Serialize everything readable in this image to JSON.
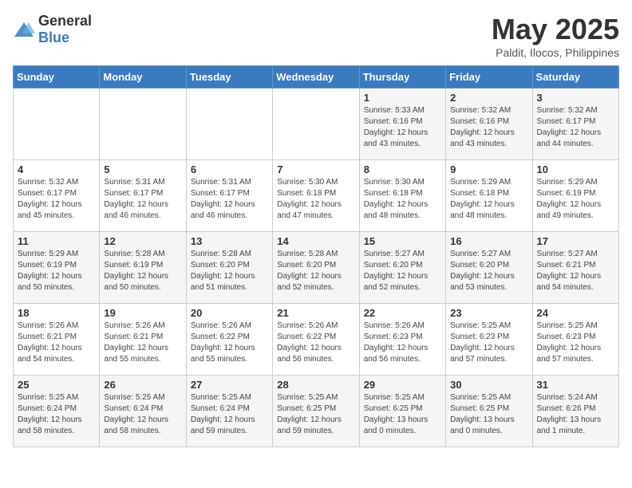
{
  "logo": {
    "text_general": "General",
    "text_blue": "Blue"
  },
  "title": "May 2025",
  "location": "Paldit, Ilocos, Philippines",
  "weekdays": [
    "Sunday",
    "Monday",
    "Tuesday",
    "Wednesday",
    "Thursday",
    "Friday",
    "Saturday"
  ],
  "weeks": [
    [
      {
        "day": "",
        "info": ""
      },
      {
        "day": "",
        "info": ""
      },
      {
        "day": "",
        "info": ""
      },
      {
        "day": "",
        "info": ""
      },
      {
        "day": "1",
        "info": "Sunrise: 5:33 AM\nSunset: 6:16 PM\nDaylight: 12 hours\nand 43 minutes."
      },
      {
        "day": "2",
        "info": "Sunrise: 5:32 AM\nSunset: 6:16 PM\nDaylight: 12 hours\nand 43 minutes."
      },
      {
        "day": "3",
        "info": "Sunrise: 5:32 AM\nSunset: 6:17 PM\nDaylight: 12 hours\nand 44 minutes."
      }
    ],
    [
      {
        "day": "4",
        "info": "Sunrise: 5:32 AM\nSunset: 6:17 PM\nDaylight: 12 hours\nand 45 minutes."
      },
      {
        "day": "5",
        "info": "Sunrise: 5:31 AM\nSunset: 6:17 PM\nDaylight: 12 hours\nand 46 minutes."
      },
      {
        "day": "6",
        "info": "Sunrise: 5:31 AM\nSunset: 6:17 PM\nDaylight: 12 hours\nand 46 minutes."
      },
      {
        "day": "7",
        "info": "Sunrise: 5:30 AM\nSunset: 6:18 PM\nDaylight: 12 hours\nand 47 minutes."
      },
      {
        "day": "8",
        "info": "Sunrise: 5:30 AM\nSunset: 6:18 PM\nDaylight: 12 hours\nand 48 minutes."
      },
      {
        "day": "9",
        "info": "Sunrise: 5:29 AM\nSunset: 6:18 PM\nDaylight: 12 hours\nand 48 minutes."
      },
      {
        "day": "10",
        "info": "Sunrise: 5:29 AM\nSunset: 6:19 PM\nDaylight: 12 hours\nand 49 minutes."
      }
    ],
    [
      {
        "day": "11",
        "info": "Sunrise: 5:29 AM\nSunset: 6:19 PM\nDaylight: 12 hours\nand 50 minutes."
      },
      {
        "day": "12",
        "info": "Sunrise: 5:28 AM\nSunset: 6:19 PM\nDaylight: 12 hours\nand 50 minutes."
      },
      {
        "day": "13",
        "info": "Sunrise: 5:28 AM\nSunset: 6:20 PM\nDaylight: 12 hours\nand 51 minutes."
      },
      {
        "day": "14",
        "info": "Sunrise: 5:28 AM\nSunset: 6:20 PM\nDaylight: 12 hours\nand 52 minutes."
      },
      {
        "day": "15",
        "info": "Sunrise: 5:27 AM\nSunset: 6:20 PM\nDaylight: 12 hours\nand 52 minutes."
      },
      {
        "day": "16",
        "info": "Sunrise: 5:27 AM\nSunset: 6:20 PM\nDaylight: 12 hours\nand 53 minutes."
      },
      {
        "day": "17",
        "info": "Sunrise: 5:27 AM\nSunset: 6:21 PM\nDaylight: 12 hours\nand 54 minutes."
      }
    ],
    [
      {
        "day": "18",
        "info": "Sunrise: 5:26 AM\nSunset: 6:21 PM\nDaylight: 12 hours\nand 54 minutes."
      },
      {
        "day": "19",
        "info": "Sunrise: 5:26 AM\nSunset: 6:21 PM\nDaylight: 12 hours\nand 55 minutes."
      },
      {
        "day": "20",
        "info": "Sunrise: 5:26 AM\nSunset: 6:22 PM\nDaylight: 12 hours\nand 55 minutes."
      },
      {
        "day": "21",
        "info": "Sunrise: 5:26 AM\nSunset: 6:22 PM\nDaylight: 12 hours\nand 56 minutes."
      },
      {
        "day": "22",
        "info": "Sunrise: 5:26 AM\nSunset: 6:23 PM\nDaylight: 12 hours\nand 56 minutes."
      },
      {
        "day": "23",
        "info": "Sunrise: 5:25 AM\nSunset: 6:23 PM\nDaylight: 12 hours\nand 57 minutes."
      },
      {
        "day": "24",
        "info": "Sunrise: 5:25 AM\nSunset: 6:23 PM\nDaylight: 12 hours\nand 57 minutes."
      }
    ],
    [
      {
        "day": "25",
        "info": "Sunrise: 5:25 AM\nSunset: 6:24 PM\nDaylight: 12 hours\nand 58 minutes."
      },
      {
        "day": "26",
        "info": "Sunrise: 5:25 AM\nSunset: 6:24 PM\nDaylight: 12 hours\nand 58 minutes."
      },
      {
        "day": "27",
        "info": "Sunrise: 5:25 AM\nSunset: 6:24 PM\nDaylight: 12 hours\nand 59 minutes."
      },
      {
        "day": "28",
        "info": "Sunrise: 5:25 AM\nSunset: 6:25 PM\nDaylight: 12 hours\nand 59 minutes."
      },
      {
        "day": "29",
        "info": "Sunrise: 5:25 AM\nSunset: 6:25 PM\nDaylight: 13 hours\nand 0 minutes."
      },
      {
        "day": "30",
        "info": "Sunrise: 5:25 AM\nSunset: 6:25 PM\nDaylight: 13 hours\nand 0 minutes."
      },
      {
        "day": "31",
        "info": "Sunrise: 5:24 AM\nSunset: 6:26 PM\nDaylight: 13 hours\nand 1 minute."
      }
    ]
  ]
}
